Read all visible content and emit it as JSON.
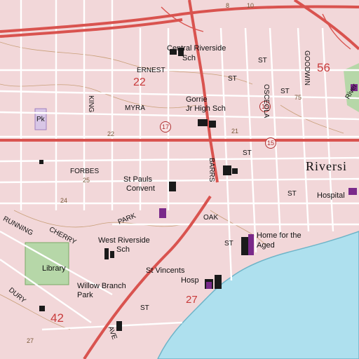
{
  "map": {
    "background_color": "#f2d7d9",
    "water_color": "#aee0ee",
    "park_color": "#b6d7a8",
    "highway_color": "#d9534f",
    "road_color": "#ffffff",
    "contour_color": "#c9a07a",
    "building_color": "#1a1a1a",
    "school_color": "#7a2a8a"
  },
  "labels": {
    "central_riverside": "Central Riverside",
    "central_riverside_sch": "Sch",
    "ernest_st": "ERNEST",
    "num_22_red": "22",
    "gorrie": "Gorrie",
    "jr_high_sch": "Jr High Sch",
    "myra_st": "MYRA",
    "num_15_shield": "15",
    "num_17_shield": "17",
    "num_21": "21",
    "num_22_street": "22",
    "forbes_st": "FORBES",
    "st_paul_convent": "St Pauls",
    "convent": "Convent",
    "park_st": "PARK",
    "oak_st": "OAK",
    "cherry_st": "CHERRY",
    "west_riverside": "West Riverside",
    "west_riverside_sch": "Sch",
    "library": "Library",
    "st_vincents": "St Vincents",
    "hosp": "Hosp",
    "willow_branch": "Willow Branch",
    "park": "Park",
    "home_for_the_aged": "Home for the",
    "aged": "Aged",
    "riverside": "Riversi",
    "hospital": "Hospital",
    "num_56": "56",
    "num_42": "42",
    "num_27_red": "27",
    "num_24": "24",
    "num_27": "27",
    "king_st": "KING",
    "barrs": "BARRS",
    "osceola": "OSCEOLA",
    "goodwin": "GOODWIN",
    "river": "River",
    "st_1": "ST",
    "st_2": "ST",
    "st_3": "ST",
    "st_4": "ST",
    "st_5": "ST",
    "st_6": "ST",
    "st_7": "ST",
    "pk": "Pk",
    "running": "RUNNING",
    "dury": "DURY",
    "ave": "AVE",
    "num_8": "8",
    "num_10": "10",
    "num_25": "25",
    "num_15b": "15",
    "num_75": "75"
  }
}
